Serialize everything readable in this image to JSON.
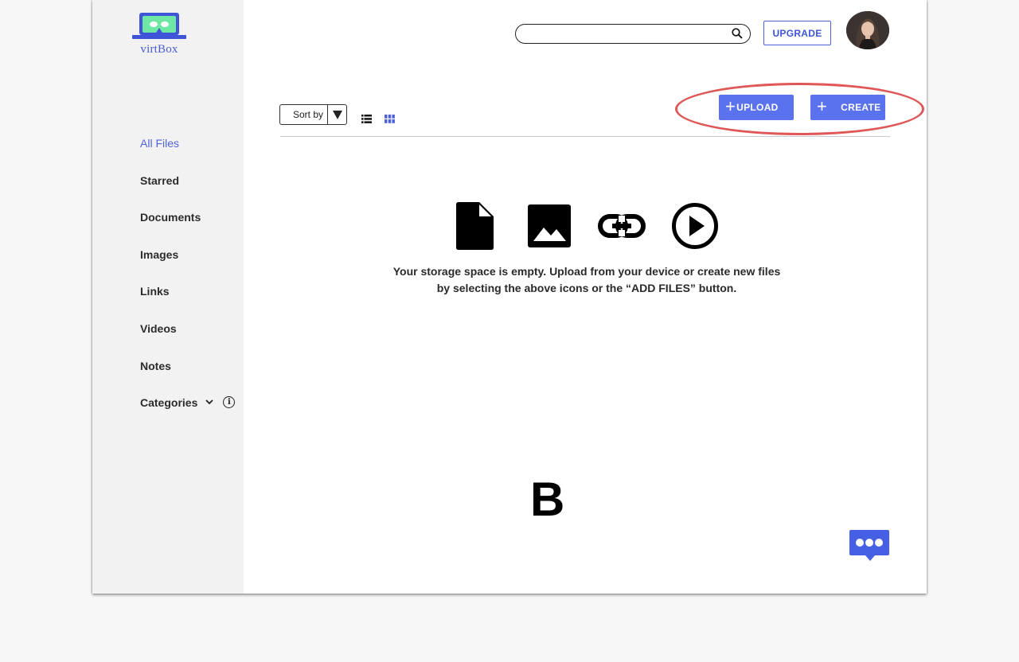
{
  "app": {
    "name": "virtBox"
  },
  "sidebar": {
    "items": [
      {
        "label": "All Files",
        "active": true
      },
      {
        "label": "Starred"
      },
      {
        "label": "Documents"
      },
      {
        "label": "Images"
      },
      {
        "label": "Links"
      },
      {
        "label": "Videos"
      },
      {
        "label": "Notes"
      },
      {
        "label": "Categories",
        "icons": [
          "chevron-down-icon",
          "info-icon"
        ]
      }
    ]
  },
  "header": {
    "search": {
      "placeholder": "",
      "value": "",
      "icon": "search-icon"
    },
    "upgrade_label": "UPGRADE",
    "avatar_icon": "avatar"
  },
  "toolbar": {
    "sort_label": "Sort by",
    "view_modes": [
      {
        "icon": "list-view-icon",
        "active": false
      },
      {
        "icon": "grid-view-icon",
        "active": true
      }
    ],
    "upload_label": "UPLOAD",
    "create_label": "CREATE"
  },
  "empty_state": {
    "icons": [
      "document-icon",
      "image-icon",
      "link-icon",
      "play-icon"
    ],
    "line1": "Your storage space is empty. Upload from your device or create new files",
    "line2": "by selecting the above icons or the “ADD FILES” button."
  },
  "annotation_letter": "B",
  "chat_icon": "chat-bubble-icon",
  "colors": {
    "accent": "#5a72ee",
    "accent_text": "#4f63d9",
    "logo_green": "#6ee7a2",
    "highlight": "#e05757",
    "sidebar_bg": "#f2f2f2"
  }
}
